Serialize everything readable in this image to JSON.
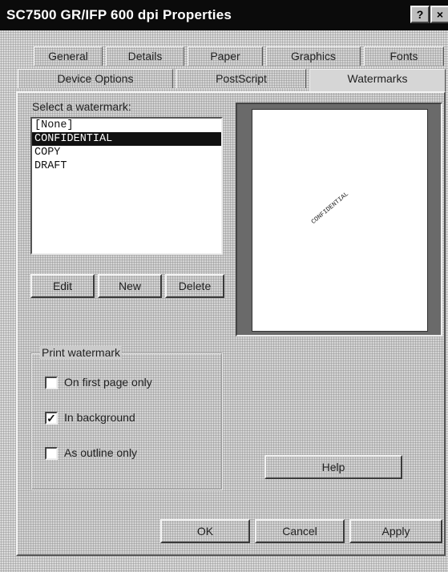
{
  "window": {
    "title": "SC7500 GR/IFP 600 dpi Properties",
    "help_glyph": "?",
    "close_glyph": "×"
  },
  "tabs_top": [
    "General",
    "Details",
    "Paper",
    "Graphics",
    "Fonts"
  ],
  "tabs_bottom": [
    "Device Options",
    "PostScript",
    "Watermarks"
  ],
  "active_tab": "Watermarks",
  "watermarks": {
    "select_label": "Select a watermark:",
    "items": [
      "[None]",
      "CONFIDENTIAL",
      "COPY",
      "DRAFT"
    ],
    "selected_index": 1,
    "edit_button": "Edit",
    "new_button": "New",
    "delete_button": "Delete",
    "preview_text": "CONFIDENTIAL"
  },
  "print_watermark": {
    "title": "Print watermark",
    "options": [
      {
        "label": "On first page only",
        "checked": false
      },
      {
        "label": "In background",
        "checked": true
      },
      {
        "label": "As outline only",
        "checked": false
      }
    ]
  },
  "buttons": {
    "help": "Help",
    "ok": "OK",
    "cancel": "Cancel",
    "apply": "Apply"
  }
}
